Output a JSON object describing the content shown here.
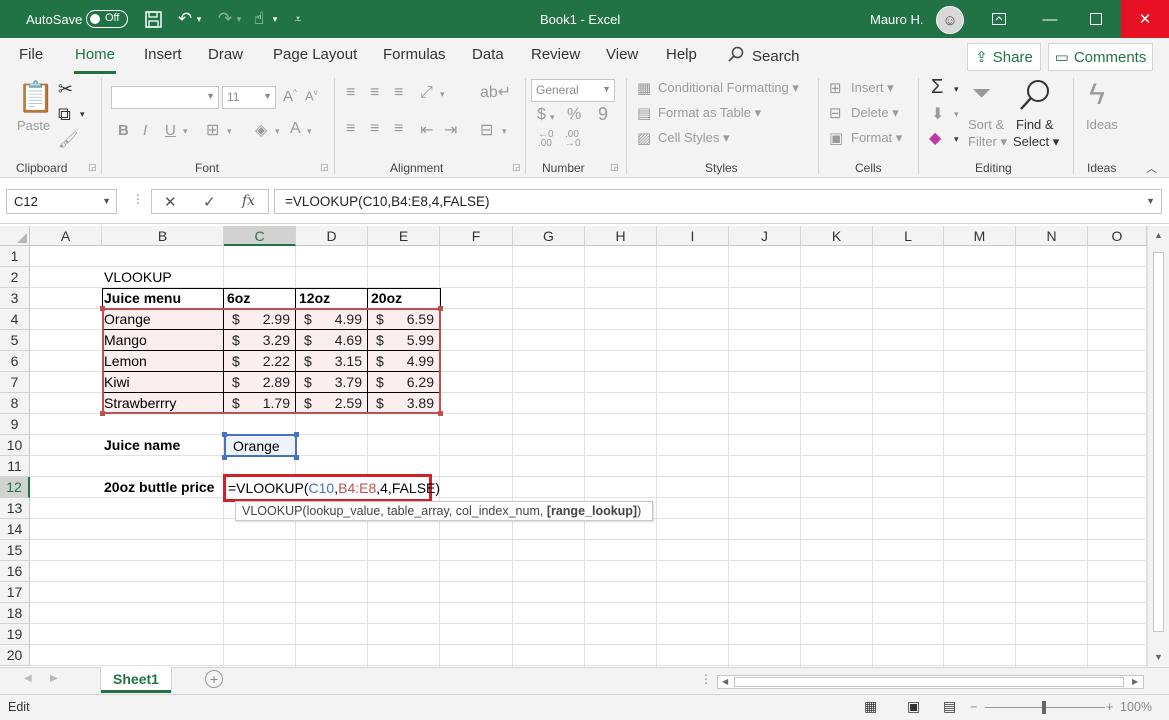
{
  "titlebar": {
    "autosave_label": "AutoSave",
    "autosave_state": "Off",
    "document_title": "Book1  -  Excel",
    "user_name": "Mauro H."
  },
  "tabs": [
    "File",
    "Home",
    "Insert",
    "Draw",
    "Page Layout",
    "Formulas",
    "Data",
    "Review",
    "View",
    "Help"
  ],
  "search_label": "Search",
  "share_label": "Share",
  "comments_label": "Comments",
  "ribbon": {
    "clipboard": {
      "label": "Clipboard",
      "paste": "Paste"
    },
    "font": {
      "label": "Font",
      "size": "11",
      "bold": "B",
      "italic": "I",
      "underline": "U"
    },
    "alignment": {
      "label": "Alignment"
    },
    "number": {
      "label": "Number",
      "format": "General",
      "currency": "$",
      "percent": "%",
      "comma": "9"
    },
    "styles": {
      "label": "Styles",
      "conditional": "Conditional Formatting",
      "format_table": "Format as Table",
      "cell_styles": "Cell Styles"
    },
    "cells": {
      "label": "Cells",
      "insert": "Insert",
      "delete": "Delete",
      "format": "Format"
    },
    "editing": {
      "label": "Editing",
      "sort_filter_1": "Sort &",
      "sort_filter_2": "Filter",
      "find_1": "Find &",
      "find_2": "Select"
    },
    "ideas": {
      "label": "Ideas",
      "button": "Ideas"
    }
  },
  "formula_bar": {
    "name_box": "C12",
    "formula": "=VLOOKUP(C10,B4:E8,4,FALSE)"
  },
  "columns": [
    "A",
    "B",
    "C",
    "D",
    "E",
    "F",
    "G",
    "H",
    "I",
    "J",
    "K",
    "L",
    "M",
    "N",
    "O"
  ],
  "rows": [
    "1",
    "2",
    "3",
    "4",
    "5",
    "6",
    "7",
    "8",
    "9",
    "10",
    "11",
    "12",
    "13",
    "14",
    "15",
    "16",
    "17",
    "18",
    "19",
    "20"
  ],
  "sheet": {
    "b2": "VLOOKUP",
    "headers": [
      "Juice menu",
      "6oz",
      "12oz",
      "20oz"
    ],
    "currency_symbol": "$",
    "items": [
      {
        "name": "Orange",
        "prices": [
          "2.99",
          "4.99",
          "6.59"
        ]
      },
      {
        "name": "Mango",
        "prices": [
          "3.29",
          "4.69",
          "5.99"
        ]
      },
      {
        "name": "Lemon",
        "prices": [
          "2.22",
          "3.15",
          "4.99"
        ]
      },
      {
        "name": "Kiwi",
        "prices": [
          "2.89",
          "3.79",
          "6.29"
        ]
      },
      {
        "name": "Strawberrry",
        "prices": [
          "1.79",
          "2.59",
          "3.89"
        ]
      }
    ],
    "b10": "Juice name",
    "c10": "Orange",
    "b12": "20oz buttle price",
    "edit_formula": {
      "prefix": "=VLOOKUP(",
      "ref1": "C10",
      "comma1": ",",
      "ref2": "B4:E8",
      "suffix": ",4,FALSE)"
    },
    "tooltip": {
      "text": "VLOOKUP(lookup_value, table_array, col_index_num, ",
      "bold": "[range_lookup]",
      "close": ")"
    }
  },
  "sheet_tab": "Sheet1",
  "status": {
    "mode": "Edit",
    "zoom": "100%"
  },
  "colors": {
    "excel_green": "#217346",
    "ref1_blue": "#4472c4",
    "ref2_red": "#c0504d",
    "close_red": "#e81123"
  }
}
